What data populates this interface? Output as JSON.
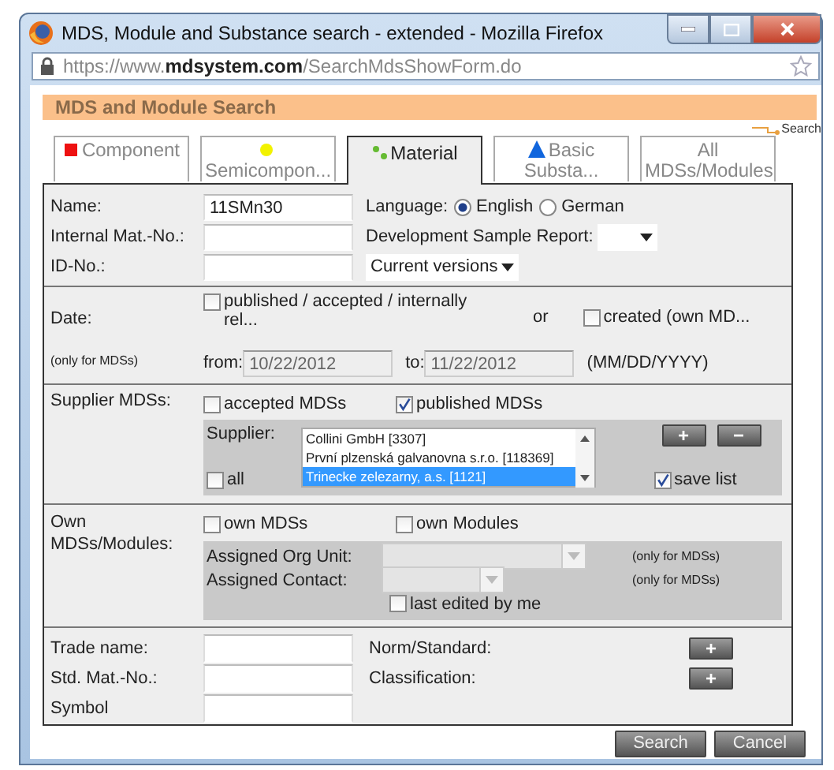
{
  "window": {
    "title": "MDS, Module and Substance search - extended - Mozilla Firefox",
    "url": "https://www.**mdsystem.com**/SearchMdsShowForm.do"
  },
  "header": "MDS and Module Search",
  "search_link": "Search",
  "tabs": [
    {
      "label": "Component",
      "kind": "square",
      "color": "#ee1111",
      "selected": false
    },
    {
      "label": "Semicompon...",
      "kind": "dot",
      "color": "#f2f200",
      "selected": false
    },
    {
      "label": "Material",
      "kind": "dots",
      "color": "#66bb33",
      "selected": true
    },
    {
      "label": "Basic Substa...",
      "kind": "triangle",
      "color": "#1166dd",
      "selected": false
    },
    {
      "label": "All MDSs/Modules",
      "kind": "none",
      "selected": false
    }
  ],
  "general": {
    "name": {
      "label": "Name:",
      "value": "11SMn30"
    },
    "internal_mat_no": {
      "label": "Internal Mat.-No.:"
    },
    "id_no": {
      "label": "ID-No.:"
    },
    "language": {
      "label": "Language:",
      "options": [
        {
          "label": "English",
          "selected": true
        },
        {
          "label": "German",
          "selected": false
        }
      ]
    },
    "dev_sample_report": {
      "label": "Development Sample Report:"
    },
    "versions": {
      "value": "Current versions"
    }
  },
  "date": {
    "label": "Date:",
    "note": "(only for MDSs)",
    "published": {
      "label": "published / accepted / internally rel...",
      "checked": false
    },
    "or": "or",
    "created": {
      "label": "created (own MD...",
      "checked": false
    },
    "from": {
      "label": "from:",
      "value": "10/22/2012"
    },
    "to": {
      "label": "to:",
      "value": "11/22/2012"
    },
    "format": "(MM/DD/YYYY)"
  },
  "supplier": {
    "label": "Supplier MDSs:",
    "accepted": {
      "label": "accepted MDSs",
      "checked": false
    },
    "published": {
      "label": "published MDSs",
      "checked": true
    },
    "list_label": "Supplier:",
    "suppliers": [
      {
        "name": "Collini GmbH [3307]",
        "selected": false
      },
      {
        "name": "První plzenská galvanovna s.r.o. [118369]",
        "selected": false
      },
      {
        "name": "Trinecke zelezarny, a.s. [1121]",
        "selected": true
      }
    ],
    "all": {
      "label": "all",
      "checked": false
    },
    "add": "+",
    "remove": "−",
    "save_list": {
      "label": "save list",
      "checked": true
    }
  },
  "own": {
    "label": "Own MDSs/Modules:",
    "own_mdss": {
      "label": "own MDSs",
      "checked": false
    },
    "own_modules": {
      "label": "own Modules",
      "checked": false
    },
    "org_unit": {
      "label": "Assigned Org Unit:",
      "note": "(only for MDSs)"
    },
    "contact": {
      "label": "Assigned Contact:",
      "note": "(only for MDSs)"
    },
    "last_edited": {
      "label": "last edited by me",
      "checked": false
    }
  },
  "trade": {
    "trade_name": {
      "label": "Trade name:"
    },
    "std_mat_no": {
      "label": "Std. Mat.-No.:"
    },
    "symbol": {
      "label": "Symbol"
    },
    "norm": {
      "label": "Norm/Standard:",
      "button": "+"
    },
    "classification": {
      "label": "Classification:",
      "button": "+"
    }
  },
  "buttons": [
    {
      "label": "Search"
    },
    {
      "label": "Cancel"
    }
  ]
}
